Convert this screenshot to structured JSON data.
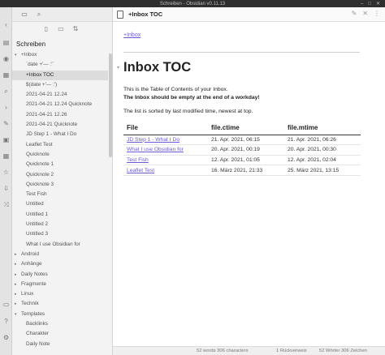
{
  "window": {
    "title": "Schreiben - Obsidian v0.11.13"
  },
  "sidebar": {
    "vault_name": "Schreiben",
    "tree": [
      {
        "label": "+Inbox",
        "depth": 0,
        "arrow": "▾",
        "selected": false
      },
      {
        "label": "`date +'— :'`",
        "depth": 1,
        "arrow": "",
        "selected": false
      },
      {
        "label": "+Inbox TOC",
        "depth": 1,
        "arrow": "",
        "selected": true
      },
      {
        "label": "$(date +'— :')",
        "depth": 1,
        "arrow": "",
        "selected": false
      },
      {
        "label": "2021-04-21 12.24",
        "depth": 1,
        "arrow": "",
        "selected": false
      },
      {
        "label": "2021-04-21 12.24 Quicknote",
        "depth": 1,
        "arrow": "",
        "selected": false
      },
      {
        "label": "2021-04-21 12.26",
        "depth": 1,
        "arrow": "",
        "selected": false
      },
      {
        "label": "2021-04-21 Quicknote",
        "depth": 1,
        "arrow": "",
        "selected": false
      },
      {
        "label": "JD Step 1 - What I Do",
        "depth": 1,
        "arrow": "",
        "selected": false
      },
      {
        "label": "Leaflet Test",
        "depth": 1,
        "arrow": "",
        "selected": false
      },
      {
        "label": "Quicknote",
        "depth": 1,
        "arrow": "",
        "selected": false
      },
      {
        "label": "Quicknote 1",
        "depth": 1,
        "arrow": "",
        "selected": false
      },
      {
        "label": "Quicknote 2",
        "depth": 1,
        "arrow": "",
        "selected": false
      },
      {
        "label": "Quicknote 3",
        "depth": 1,
        "arrow": "",
        "selected": false
      },
      {
        "label": "Test Fish",
        "depth": 1,
        "arrow": "",
        "selected": false
      },
      {
        "label": "Untitled",
        "depth": 1,
        "arrow": "",
        "selected": false
      },
      {
        "label": "Untitled 1",
        "depth": 1,
        "arrow": "",
        "selected": false
      },
      {
        "label": "Untitled 2",
        "depth": 1,
        "arrow": "",
        "selected": false
      },
      {
        "label": "Untitled 3",
        "depth": 1,
        "arrow": "",
        "selected": false
      },
      {
        "label": "What I use Obsidian for",
        "depth": 1,
        "arrow": "",
        "selected": false
      },
      {
        "label": "Android",
        "depth": 0,
        "arrow": "▸",
        "selected": false
      },
      {
        "label": "Anhänge",
        "depth": 0,
        "arrow": "▸",
        "selected": false
      },
      {
        "label": "Daily Notes",
        "depth": 0,
        "arrow": "▸",
        "selected": false
      },
      {
        "label": "Fragmente",
        "depth": 0,
        "arrow": "▸",
        "selected": false
      },
      {
        "label": "Linux",
        "depth": 0,
        "arrow": "▸",
        "selected": false
      },
      {
        "label": "Technik",
        "depth": 0,
        "arrow": "▸",
        "selected": false
      },
      {
        "label": "Templates",
        "depth": 0,
        "arrow": "▾",
        "selected": false
      },
      {
        "label": "Backlinks",
        "depth": 1,
        "arrow": "",
        "selected": false
      },
      {
        "label": "Charakter",
        "depth": 1,
        "arrow": "",
        "selected": false
      },
      {
        "label": "Daily Note",
        "depth": 1,
        "arrow": "",
        "selected": false
      }
    ]
  },
  "tab": {
    "title": "+Inbox TOC"
  },
  "note": {
    "backlink": "+Inbox",
    "heading": "Inbox TOC",
    "line1": "This is the Table of Contents of your Inbox.",
    "line2": "The Inbox should be empty at the end of a workday!",
    "line3": "The list is sorted by last modified time, newest at top.",
    "table": {
      "headers": [
        "File",
        "file.ctime",
        "file.mtime"
      ],
      "rows": [
        [
          "JD Step 1 - What I Do",
          "21. Apr. 2021, 06:15",
          "21. Apr. 2021, 06:26"
        ],
        [
          "What I use Obsidian for",
          "20. Apr. 2021, 00:19",
          "20. Apr. 2021, 00:30"
        ],
        [
          "Test Fish",
          "12. Apr. 2021, 01:05",
          "12. Apr. 2021, 02:04"
        ],
        [
          "Leaflet Test",
          "16. März 2021, 21:33",
          "25. März 2021, 13:15"
        ]
      ]
    }
  },
  "status": {
    "words_chars": "52 words 306 characters",
    "backlinks": "1 Rückverweis",
    "words_chars_de": "52 Wörter 306 Zeichen"
  },
  "colors": {
    "link": "#6b5bd3",
    "selected_row": "#dcdcdc"
  }
}
